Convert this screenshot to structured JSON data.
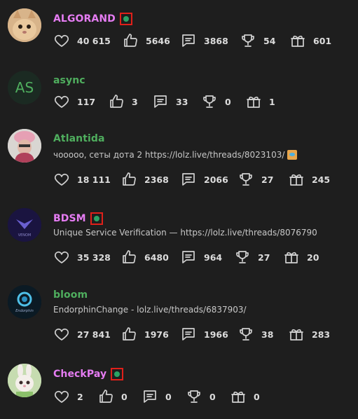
{
  "users": [
    {
      "username": "ALGORAND",
      "username_color": "#e57cf2",
      "avatar": "cat",
      "online": true,
      "status": "",
      "stats": {
        "likes": "40 615",
        "thumbs": "5646",
        "messages": "3868",
        "trophies": "54",
        "gifts": "601"
      }
    },
    {
      "username": "async",
      "username_color": "#4fae5e",
      "avatar": "AS",
      "online": false,
      "status": "",
      "stats": {
        "likes": "117",
        "thumbs": "3",
        "messages": "33",
        "trophies": "0",
        "gifts": "1"
      }
    },
    {
      "username": "Atlantida",
      "username_color": "#4fae5e",
      "avatar": "person-pink-hat",
      "online": false,
      "status": "чооооо, сеты дота 2 https://lolz.live/threads/8023103/",
      "stats": {
        "likes": "18 111",
        "thumbs": "2368",
        "messages": "2066",
        "trophies": "27",
        "gifts": "245"
      }
    },
    {
      "username": "BDSM",
      "username_color": "#e57cf2",
      "avatar": "venom-logo",
      "online": true,
      "status": "Unique Service Verification — https://lolz.live/threads/8076790",
      "stats": {
        "likes": "35 328",
        "thumbs": "6480",
        "messages": "964",
        "trophies": "27",
        "gifts": "20"
      }
    },
    {
      "username": "bloom",
      "username_color": "#4fae5e",
      "avatar": "endorphin-logo",
      "online": false,
      "status": "EndorphinChange - lolz.live/threads/6837903/",
      "stats": {
        "likes": "27 841",
        "thumbs": "1976",
        "messages": "1966",
        "trophies": "38",
        "gifts": "283"
      }
    },
    {
      "username": "CheckPay",
      "username_color": "#e57cf2",
      "avatar": "bunny",
      "online": true,
      "status": "",
      "stats": {
        "likes": "2",
        "thumbs": "0",
        "messages": "0",
        "trophies": "0",
        "gifts": "0"
      }
    }
  ]
}
